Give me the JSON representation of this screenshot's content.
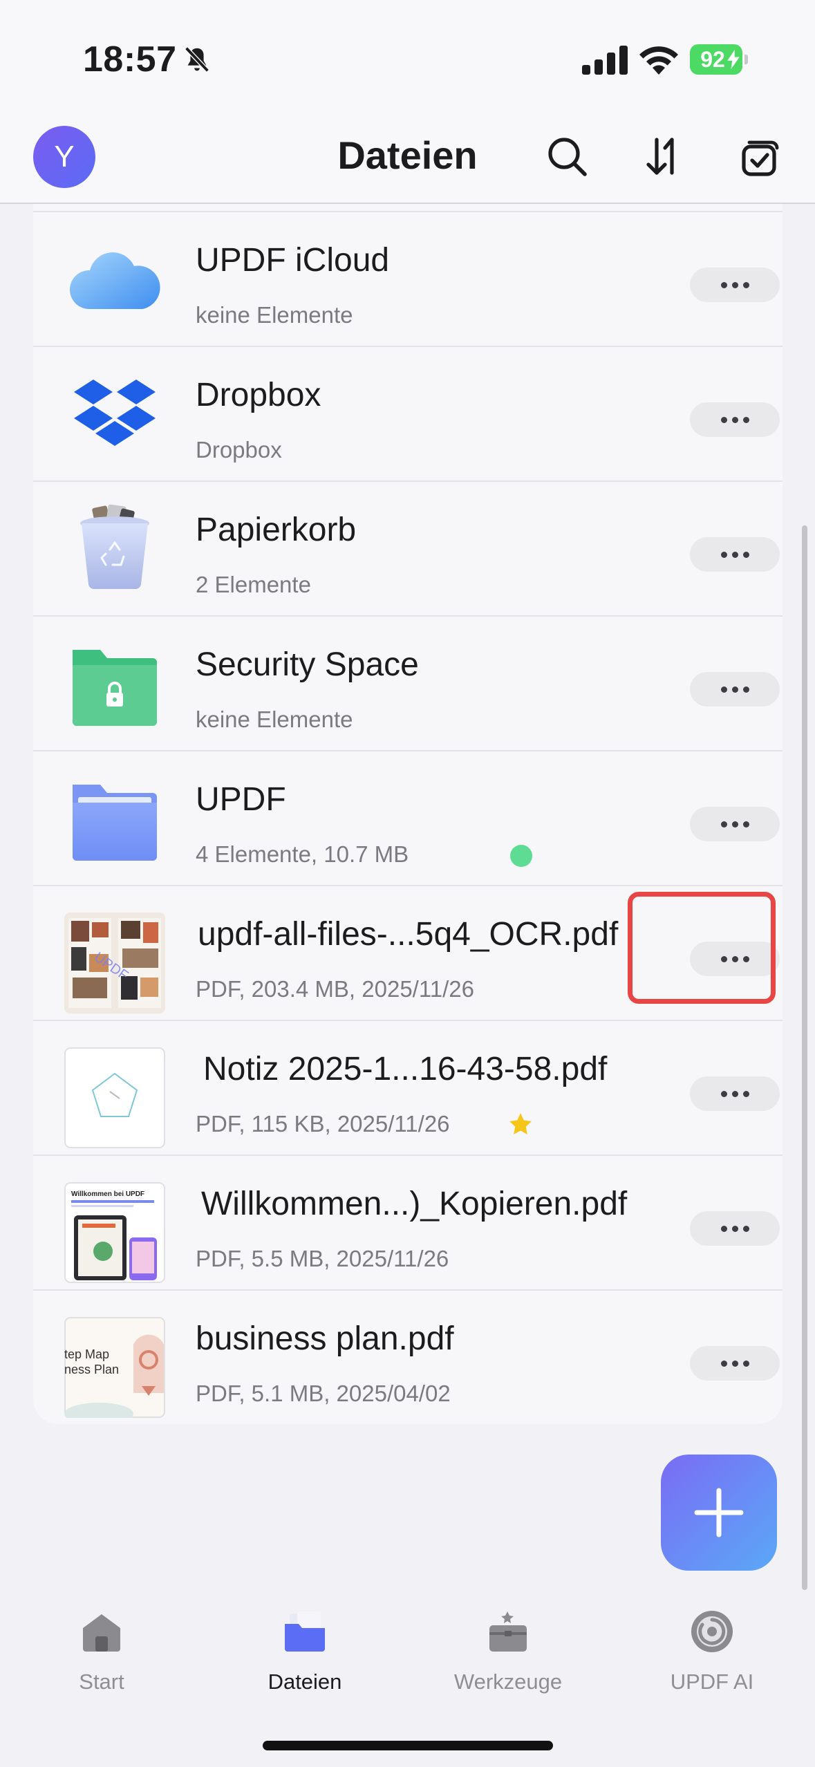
{
  "status_bar": {
    "time": "18:57",
    "battery": "92"
  },
  "nav": {
    "avatar_letter": "Y",
    "title": "Dateien"
  },
  "items": [
    {
      "name": "UPDF iCloud",
      "meta": "keine Elemente",
      "icon": "icloud-icon"
    },
    {
      "name": "Dropbox",
      "meta": "Dropbox",
      "icon": "dropbox-icon"
    },
    {
      "name": "Papierkorb",
      "meta": "2 Elemente",
      "icon": "trash-icon"
    },
    {
      "name": "Security Space",
      "meta": "keine Elemente",
      "icon": "secure-folder-icon"
    },
    {
      "name": "UPDF",
      "meta": "4 Elemente, 10.7 MB",
      "icon": "folder-icon"
    },
    {
      "name": "updf-all-files-...5q4_OCR.pdf",
      "meta": "PDF, 203.4 MB, 2025/11/26",
      "icon": "pdf-thumbnail"
    },
    {
      "name": "Notiz 2025-1...16-43-58.pdf",
      "meta": "PDF, 115 KB, 2025/11/26",
      "icon": "pdf-thumbnail"
    },
    {
      "name": "Willkommen...)_Kopieren.pdf",
      "meta": "PDF, 5.5 MB, 2025/11/26",
      "icon": "pdf-thumbnail"
    },
    {
      "name": "business plan.pdf",
      "meta": "PDF, 5.1 MB, 2025/04/02",
      "icon": "pdf-thumbnail"
    }
  ],
  "thumb_text": {
    "willkommen": "Willkommen bei UPDF",
    "business": "tep Map\nness Plan"
  },
  "tabs": [
    {
      "label": "Start",
      "icon": "home-icon"
    },
    {
      "label": "Dateien",
      "icon": "files-icon",
      "active": true
    },
    {
      "label": "Werkzeuge",
      "icon": "toolbox-icon"
    },
    {
      "label": "UPDF AI",
      "icon": "ai-icon"
    }
  ],
  "colors": {
    "accent": "#5b6cf5",
    "highlight": "#e84545",
    "sync_dot": "#5fdc94",
    "star": "#f5c518"
  }
}
